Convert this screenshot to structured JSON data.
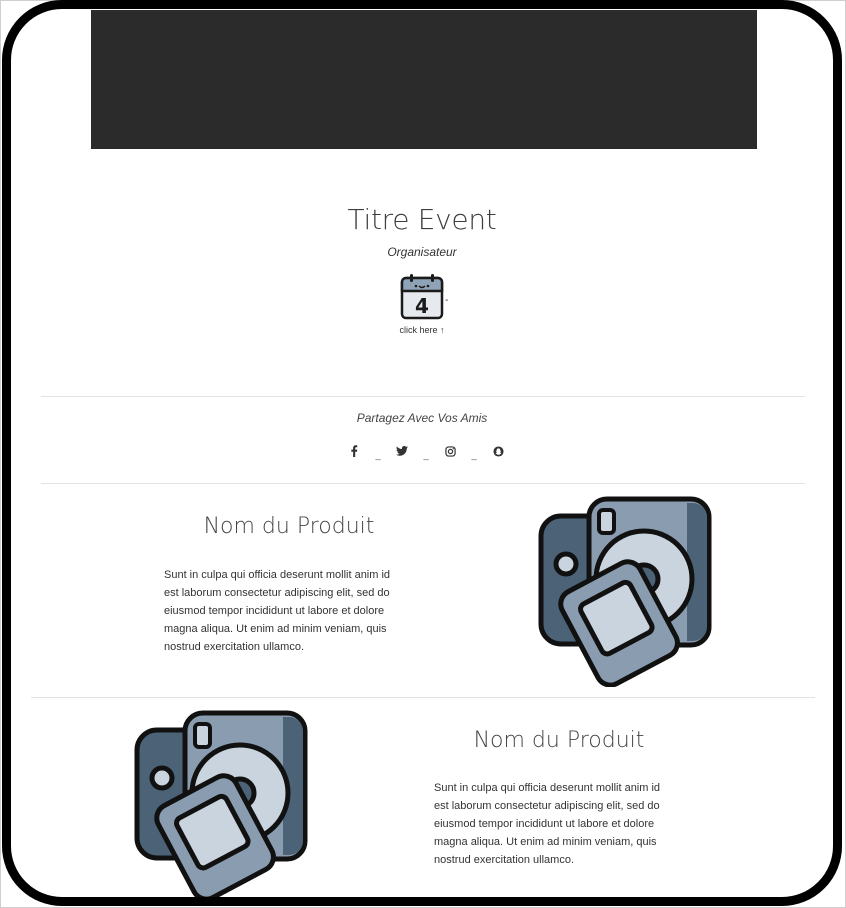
{
  "event": {
    "title": "Titre Event",
    "organizer": "Organisateur",
    "calendar_day": "4",
    "calendar_dash": "-",
    "click_here": "click here ↑"
  },
  "share": {
    "title": "Partagez Avec Vos Amis",
    "separator": "_",
    "icons": [
      "facebook-icon",
      "twitter-icon",
      "instagram-icon",
      "snapchat-icon"
    ]
  },
  "products": [
    {
      "title": "Nom du Produit",
      "description": "Sunt in culpa qui officia deserunt mollit anim id est laborum consectetur adipiscing elit, sed do eiusmod tempor incididunt ut labore et dolore magna aliqua. Ut enim ad minim veniam, quis nostrud exercitation ullamco.",
      "image_icon": "camera-icon"
    },
    {
      "title": "Nom du Produit",
      "description": "Sunt in culpa qui officia deserunt mollit anim id est laborum consectetur adipiscing elit, sed do eiusmod tempor incididunt ut labore et dolore magna aliqua. Ut enim ad minim veniam, quis nostrud exercitation ullamco.",
      "image_icon": "camera-icon"
    }
  ],
  "colors": {
    "banner": "#2b2b2b",
    "frame": "#000000",
    "divider": "#e2e2e2",
    "icon_dark": "#4c6377",
    "icon_mid": "#8a9db0",
    "icon_light": "#c9d4de"
  }
}
